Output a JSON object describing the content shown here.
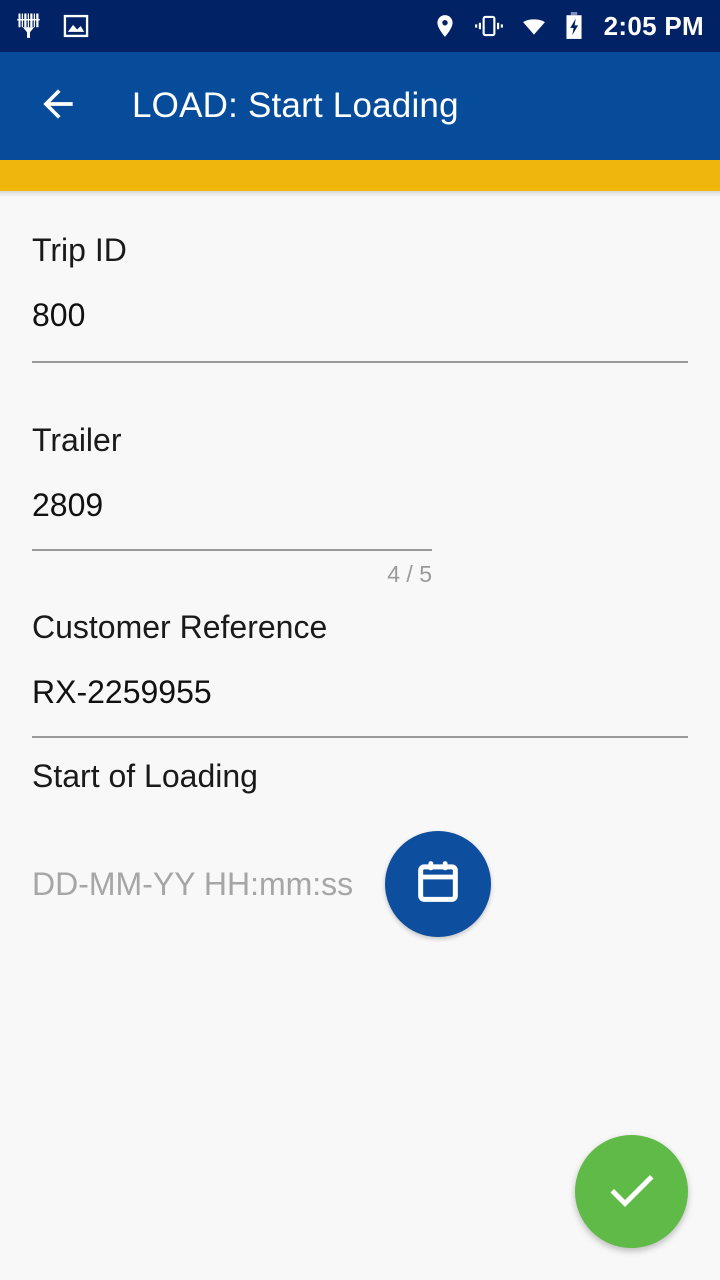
{
  "status_bar": {
    "icons_left": [
      "barcode-scanner-icon",
      "image-icon"
    ],
    "icons_right": [
      "location-pin-icon",
      "vibrate-icon",
      "wifi-icon",
      "battery-charging-icon"
    ],
    "time": "2:05 PM",
    "background_color": "#012366"
  },
  "app_bar": {
    "back_icon": "arrow-left-icon",
    "title": "LOAD: Start Loading",
    "background_color": "#064c9b"
  },
  "accent_bar": {
    "color": "#efb60c"
  },
  "form": {
    "fields": [
      {
        "label": "Trip ID",
        "value": "800",
        "placeholder": ""
      },
      {
        "label": "Trailer",
        "value": "2809",
        "placeholder": "",
        "counter": "4 / 5"
      },
      {
        "label": "Customer Reference",
        "value": "RX-2259955",
        "placeholder": ""
      },
      {
        "label": "Start of Loading",
        "value": "",
        "placeholder": "DD-MM-YY HH:mm:ss"
      }
    ]
  },
  "buttons": {
    "calendar": {
      "icon": "calendar-icon",
      "color": "#0d4f9e"
    },
    "confirm": {
      "icon": "check-icon",
      "color": "#5fba47"
    }
  }
}
